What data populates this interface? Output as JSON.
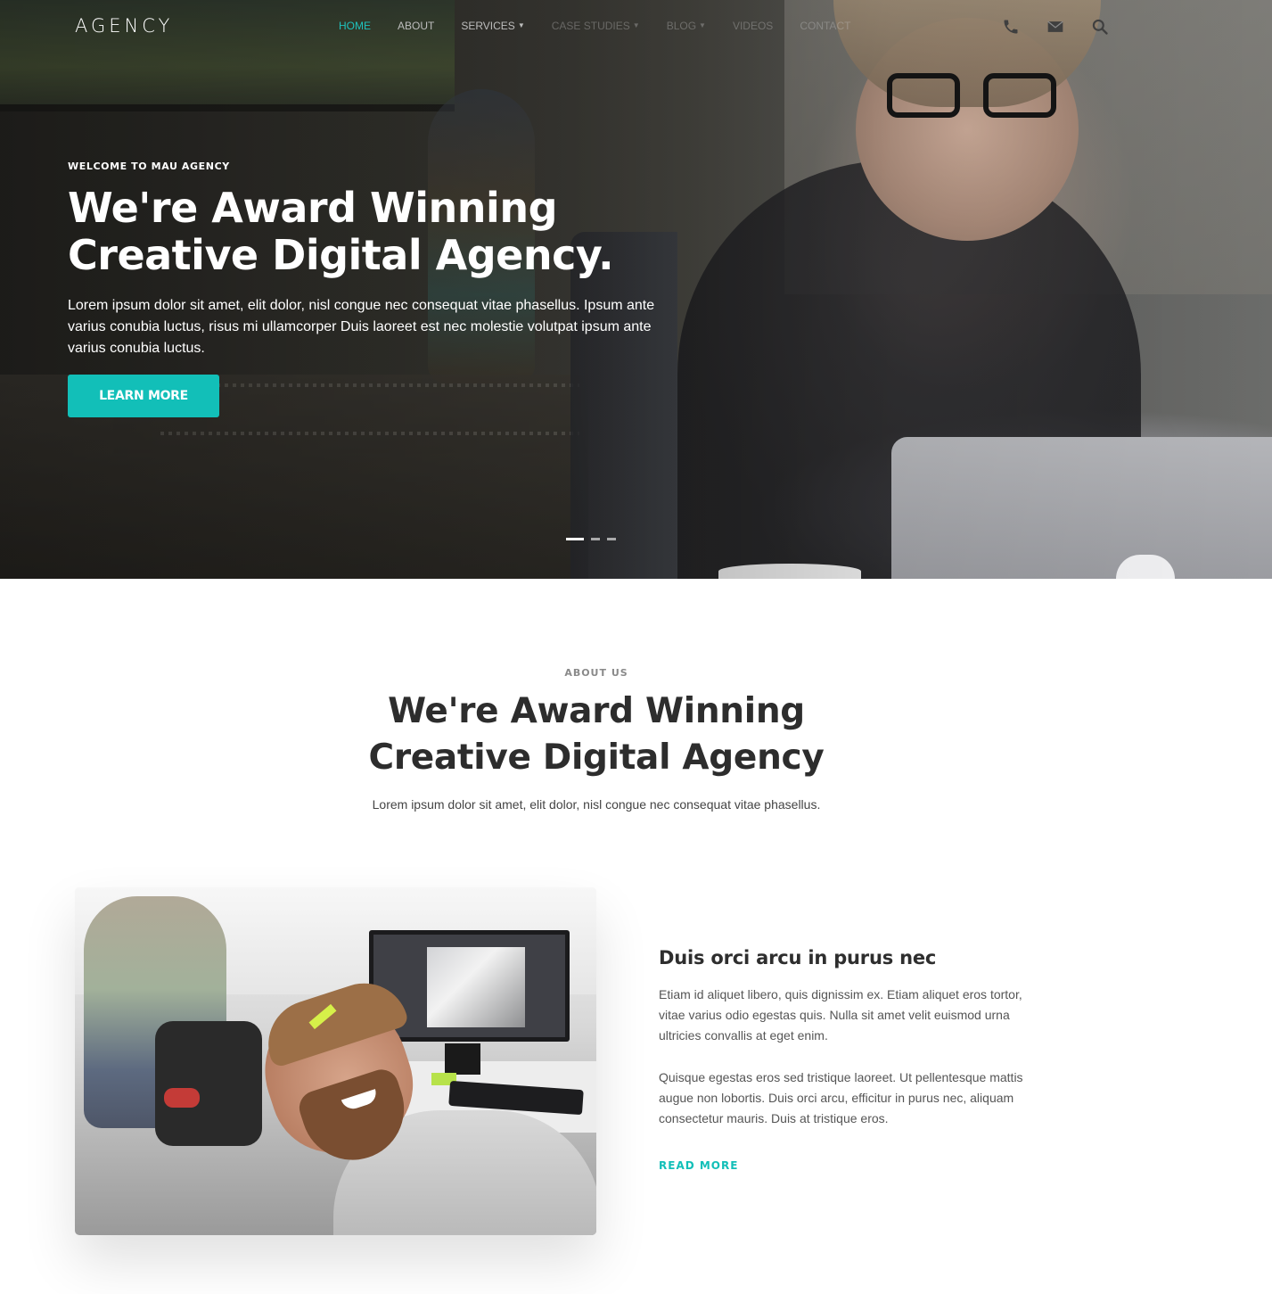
{
  "brand": {
    "logo": "AGENCY",
    "accent_color": "#12BFB8"
  },
  "nav": {
    "items": [
      {
        "label": "Home",
        "active": true
      },
      {
        "label": "About"
      },
      {
        "label": "Services",
        "dropdown": true
      },
      {
        "label": "Case Studies",
        "dropdown": true
      },
      {
        "label": "Blog",
        "dropdown": true
      },
      {
        "label": "Videos"
      },
      {
        "label": "Contact"
      }
    ],
    "icons": [
      "phone-icon",
      "envelope-icon",
      "search-icon"
    ]
  },
  "hero": {
    "kicker": "WELCOME TO MAU AGENCY",
    "title_line1": "We're Award Winning",
    "title_line2": "Creative Digital Agency.",
    "description": "Lorem ipsum dolor sit amet, elit dolor, nisl congue nec consequat vitae phasellus. Ipsum ante varius conubia luctus, risus mi ullamcorper Duis laoreet est nec molestie volutpat ipsum ante varius conubia luctus.",
    "button_label": "LEARN MORE",
    "slides_total": 3,
    "active_slide": 1
  },
  "about": {
    "kicker": "ABOUT US",
    "title_line1": "We're Award Winning",
    "title_line2": "Creative Digital Agency",
    "subtitle": "Lorem ipsum dolor sit amet, elit dolor, nisl congue nec consequat vitae phasellus."
  },
  "feature": {
    "title": "Duis orci arcu in purus nec",
    "paragraph1": "Etiam id aliquet libero, quis dignissim ex. Etiam aliquet eros tortor, vitae varius odio egestas quis. Nulla sit amet velit euismod urna ultricies convallis at eget enim.",
    "paragraph2": "Quisque egestas eros sed tristique laoreet. Ut pellentesque mattis augue non lobortis. Duis orci arcu, efficitur in purus nec, aliquam consectetur mauris. Duis at tristique eros.",
    "link_label": "READ MORE"
  }
}
